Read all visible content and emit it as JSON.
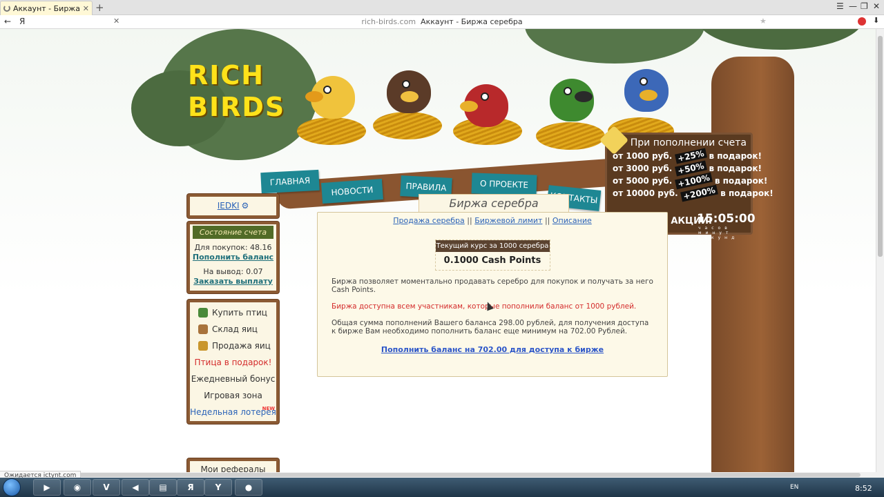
{
  "browser": {
    "tab_title": "Аккаунт - Биржа серебр",
    "tab_close": "✕",
    "new_tab": "+",
    "back": "←",
    "yandex": "Я",
    "clear": "✕",
    "url_domain": "rich-birds.com",
    "url_title": "Аккаунт - Биржа серебра",
    "star": "★",
    "download": "⬇",
    "win_controls": [
      "☰",
      "—",
      "❐",
      "✕"
    ],
    "status": "Ожидается ictynt.com"
  },
  "site": {
    "logo_line1": "RICH",
    "logo_line2": "BIRDS",
    "nav": [
      "ГЛАВНАЯ",
      "НОВОСТИ",
      "ПРАВИЛА",
      "О ПРОЕКТЕ",
      "КОНТАКТЫ"
    ],
    "promo": {
      "head": "При пополнении счета",
      "rows": [
        {
          "from": "от 1000 руб.",
          "pct": "+25%",
          "tail": "в подарок!"
        },
        {
          "from": "от 3000 руб.",
          "pct": "+50%",
          "tail": "в подарок!"
        },
        {
          "from": "от 5000 руб.",
          "pct": "+100%",
          "tail": "в подарок!"
        },
        {
          "from": "от 10000 руб.",
          "pct": "+200%",
          "tail": "в подарок!"
        }
      ],
      "foot": "ДО КОНЦА АКЦИИ:",
      "timer": "15:05:00",
      "units": "часов минут секунд"
    }
  },
  "sidebar": {
    "username": "IEDKI",
    "gear": "⚙",
    "account": {
      "title": "Состояние счета",
      "buy_line": "Для покупок: 48.16",
      "topup_link": "Пополнить баланс",
      "withdraw_line": "На вывод: 0.07",
      "payout_link": "Заказать выплату"
    },
    "menu": [
      {
        "label": "Купить птиц",
        "color": "#4a8a3a"
      },
      {
        "label": "Склад яиц",
        "color": "#a8733c"
      },
      {
        "label": "Продажа яиц",
        "color": "#c9962c"
      },
      {
        "label": "Птица в подарок!"
      },
      {
        "label": "Ежедневный бонус"
      },
      {
        "label": "Игровая зона"
      },
      {
        "label": "Недельная лотерея",
        "badge": "NEW"
      }
    ],
    "refs": "Мои рефералы"
  },
  "main": {
    "title": "Биржа серебра",
    "tabs": [
      "Продажа серебра",
      "Биржевой лимит",
      "Описание"
    ],
    "tab_sep": "||",
    "rate_label": "Текущий курс за 1000 серебра",
    "rate_value": "0.1000 Cash Points",
    "p1": "Биржа позволяет моментально продавать серебро для покупок и получать за него Cash Points.",
    "p2": "Биржа доступна всем участникам, которые пополнили баланс от 1000 рублей.",
    "p3": "Общая сумма пополнений Вашего баланса 298.00 рублей, для получения доступа к бирже Вам необходимо пополнить баланс еще минимум на 702.00 Рублей.",
    "topup_link": "Пополнить баланс на 702.00 для доступа к бирже"
  },
  "taskbar": {
    "apps": [
      "▶",
      "◉",
      "V",
      "◀",
      "▤",
      "Я",
      "Y",
      "●"
    ],
    "lang": "EN",
    "time": "8:52"
  }
}
